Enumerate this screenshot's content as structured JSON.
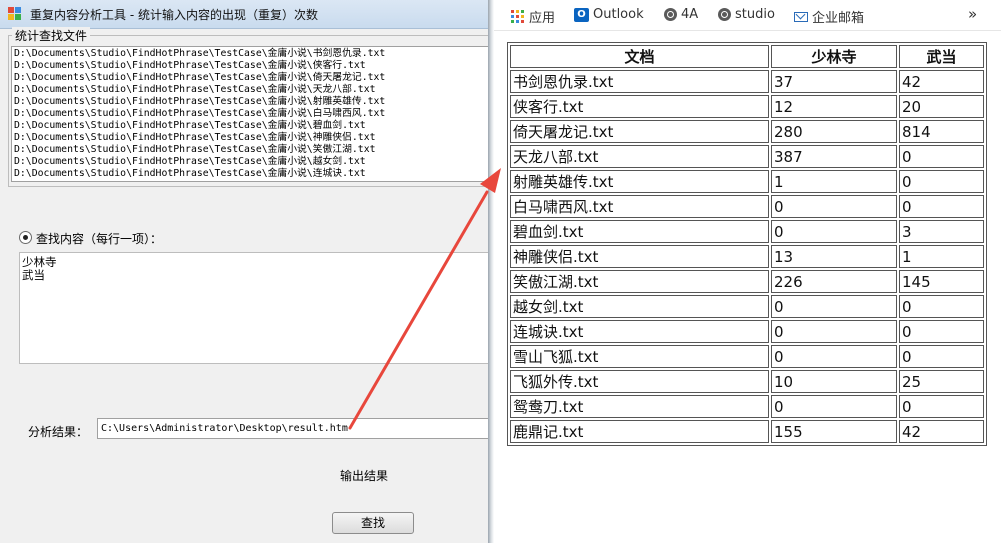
{
  "app": {
    "title": "重复内容分析工具 - 统计输入内容的出现（重复）次数",
    "files_group_label": "统计查找文件",
    "files": [
      "D:\\Documents\\Studio\\FindHotPhrase\\TestCase\\金庸小说\\书剑恩仇录.txt",
      "D:\\Documents\\Studio\\FindHotPhrase\\TestCase\\金庸小说\\侠客行.txt",
      "D:\\Documents\\Studio\\FindHotPhrase\\TestCase\\金庸小说\\倚天屠龙记.txt",
      "D:\\Documents\\Studio\\FindHotPhrase\\TestCase\\金庸小说\\天龙八部.txt",
      "D:\\Documents\\Studio\\FindHotPhrase\\TestCase\\金庸小说\\射雕英雄传.txt",
      "D:\\Documents\\Studio\\FindHotPhrase\\TestCase\\金庸小说\\白马啸西风.txt",
      "D:\\Documents\\Studio\\FindHotPhrase\\TestCase\\金庸小说\\碧血剑.txt",
      "D:\\Documents\\Studio\\FindHotPhrase\\TestCase\\金庸小说\\神雕侠侣.txt",
      "D:\\Documents\\Studio\\FindHotPhrase\\TestCase\\金庸小说\\笑傲江湖.txt",
      "D:\\Documents\\Studio\\FindHotPhrase\\TestCase\\金庸小说\\越女剑.txt",
      "D:\\Documents\\Studio\\FindHotPhrase\\TestCase\\金庸小说\\连城诀.txt"
    ],
    "radio_label": "查找内容（每行一项）：",
    "search_terms": [
      "少林寺",
      "武当"
    ],
    "result_label": "分析结果：",
    "result_path": "C:\\Users\\Administrator\\Desktop\\result.htm",
    "output_label": "输出结果",
    "search_button": "查找"
  },
  "browser": {
    "bookmarks": [
      {
        "label": "应用",
        "icon": "apps-grid-icon"
      },
      {
        "label": "Outlook",
        "icon": "outlook-icon"
      },
      {
        "label": "4A",
        "icon": "globe-icon"
      },
      {
        "label": "studio",
        "icon": "globe-icon"
      },
      {
        "label": "企业邮箱",
        "icon": "mail-icon"
      }
    ],
    "more_symbol": "»",
    "table": {
      "headers": [
        "文档",
        "少林寺",
        "武当"
      ],
      "rows": [
        [
          "书剑恩仇录.txt",
          "37",
          "42"
        ],
        [
          "侠客行.txt",
          "12",
          "20"
        ],
        [
          "倚天屠龙记.txt",
          "280",
          "814"
        ],
        [
          "天龙八部.txt",
          "387",
          "0"
        ],
        [
          "射雕英雄传.txt",
          "1",
          "0"
        ],
        [
          "白马啸西风.txt",
          "0",
          "0"
        ],
        [
          "碧血剑.txt",
          "0",
          "3"
        ],
        [
          "神雕侠侣.txt",
          "13",
          "1"
        ],
        [
          "笑傲江湖.txt",
          "226",
          "145"
        ],
        [
          "越女剑.txt",
          "0",
          "0"
        ],
        [
          "连城诀.txt",
          "0",
          "0"
        ],
        [
          "雪山飞狐.txt",
          "0",
          "0"
        ],
        [
          "飞狐外传.txt",
          "10",
          "25"
        ],
        [
          "鸳鸯刀.txt",
          "0",
          "0"
        ],
        [
          "鹿鼎记.txt",
          "155",
          "42"
        ]
      ]
    }
  },
  "colors": {
    "annotation_arrow": "#e8473c",
    "outlook_blue": "#0a64c0"
  }
}
